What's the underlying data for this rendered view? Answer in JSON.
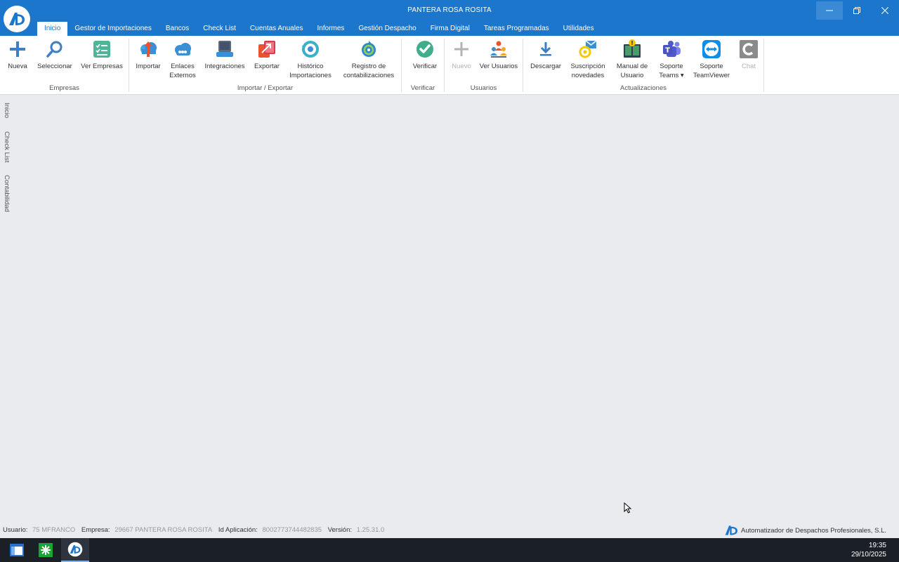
{
  "window": {
    "title": "PANTERA ROSA ROSITA"
  },
  "menu": {
    "tabs": [
      "Inicio",
      "Gestor de Importaciones",
      "Bancos",
      "Check List",
      "Cuentas Anuales",
      "Informes",
      "Gestión Despacho",
      "Firma Digital",
      "Tareas Programadas",
      "Utilidades"
    ],
    "active_index": 0
  },
  "ribbon": {
    "groups": {
      "empresas": "Empresas",
      "importar_exportar": "Importar / Exportar",
      "verificar": "Verificar",
      "usuarios": "Usuarios",
      "actualizaciones": "Actualizaciones"
    },
    "buttons": {
      "nueva": "Nueva",
      "seleccionar": "Seleccionar",
      "ver_empresas": "Ver Empresas",
      "importar": "Importar",
      "enlaces_1": "Enlaces",
      "enlaces_2": "Externos",
      "integraciones": "Integraciones",
      "exportar": "Exportar",
      "historico_1": "Histórico",
      "historico_2": "Importaciones",
      "registro_1": "Registro de",
      "registro_2": "contabilizaciones",
      "verificar": "Verificar",
      "nuevo": "Nuevo",
      "ver_usuarios": "Ver Usuarios",
      "descargar": "Descargar",
      "suscripcion_1": "Suscripción",
      "suscripcion_2": "novedades",
      "manual_1": "Manual de",
      "manual_2": "Usuario",
      "teams_1": "Soporte",
      "teams_2": "Teams ▾",
      "teamviewer_1": "Soporte",
      "teamviewer_2": "TeamViewer",
      "chat": "Chat"
    }
  },
  "side_tabs": [
    "Inicio",
    "Check List",
    "Contabilidad"
  ],
  "status": {
    "usuario_label": "Usuario:",
    "usuario_value": "75  MFRANCO",
    "empresa_label": "Empresa:",
    "empresa_value": "29667  PANTERA ROSA ROSITA",
    "id_label": "Id Aplicación:",
    "id_value": "8002773744482835",
    "version_label": "Versión:",
    "version_value": "1.25.31.0",
    "company": "Automatizador de Despachos Profesionales, S.L."
  },
  "taskbar": {
    "time": "19:35",
    "date": "29/10/2025"
  },
  "colors": {
    "title_bar": "#1c76cc",
    "ribbon_bg": "#ffffff",
    "workspace_bg": "#e9ebee",
    "taskbar": "#1b1f26"
  }
}
